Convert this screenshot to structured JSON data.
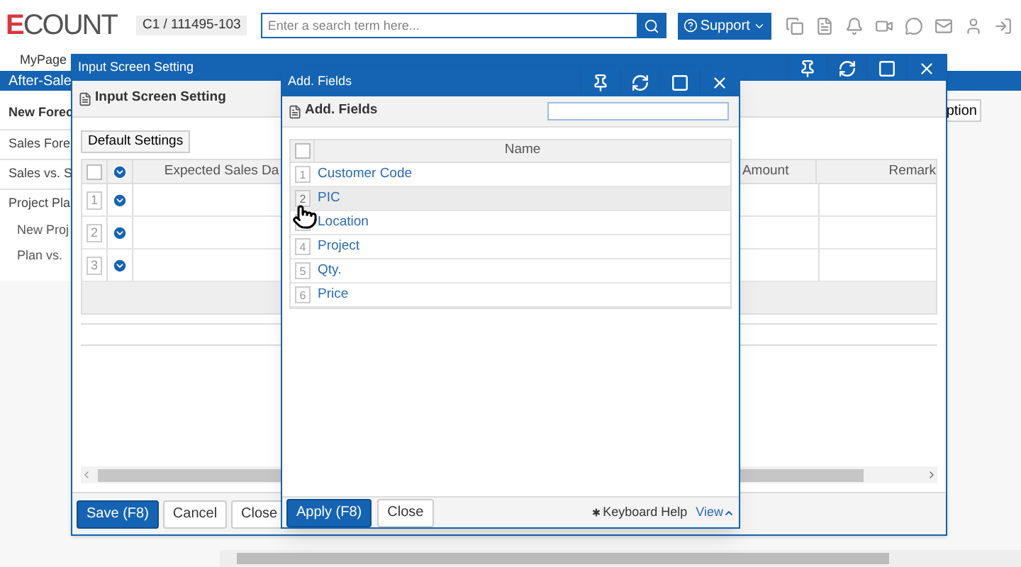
{
  "header": {
    "logo_accent": "E",
    "logo_rest": "COUNT",
    "account": "C1 / 111495-103",
    "search": {
      "placeholder": "Enter a search term here..."
    },
    "support": "Support"
  },
  "nav": {
    "tab": "MyPage",
    "section": "After-Sale"
  },
  "menu": [
    {
      "label": "New Forec",
      "kind": "heading"
    },
    {
      "label": "Sales Fore",
      "kind": "item"
    },
    {
      "label": "Sales vs. S",
      "kind": "item"
    },
    {
      "label": "Project Pla",
      "kind": "item"
    },
    {
      "label": "New Proj",
      "kind": "subitem"
    },
    {
      "label": "Plan vs.",
      "kind": "subitem"
    }
  ],
  "background_button": "ption",
  "input_window": {
    "all_checked": false,
    "title": "Input Screen Setting",
    "heading": "Input Screen Setting",
    "default_button": "Default Settings",
    "columns": [
      "Expected Sales Da",
      "Amount",
      "Remark"
    ],
    "rows": [
      "1",
      "2",
      "3"
    ],
    "buttons": [
      {
        "label": "Save (F8)",
        "primary": true
      },
      {
        "label": "Cancel",
        "primary": false
      },
      {
        "label": "Close",
        "primary": false
      }
    ]
  },
  "fields_window": {
    "all_checked": false,
    "title": "Add. Fields",
    "heading": "Add. Fields",
    "column": "Name",
    "rows": [
      {
        "number": "1",
        "name": "Customer Code",
        "hovered": false
      },
      {
        "number": "2",
        "name": "PIC",
        "hovered": true
      },
      {
        "name": "Location",
        "hovered": false
      },
      {
        "number": "4",
        "name": "Project",
        "hovered": false
      },
      {
        "number": "5",
        "name": "Qty.",
        "hovered": false
      },
      {
        "number": "6",
        "name": "Price",
        "hovered": false
      }
    ],
    "buttons": [
      {
        "label": "Apply (F8)",
        "primary": true
      },
      {
        "label": "Close",
        "primary": false
      }
    ],
    "help": "Keyboard Help",
    "view": "View"
  }
}
